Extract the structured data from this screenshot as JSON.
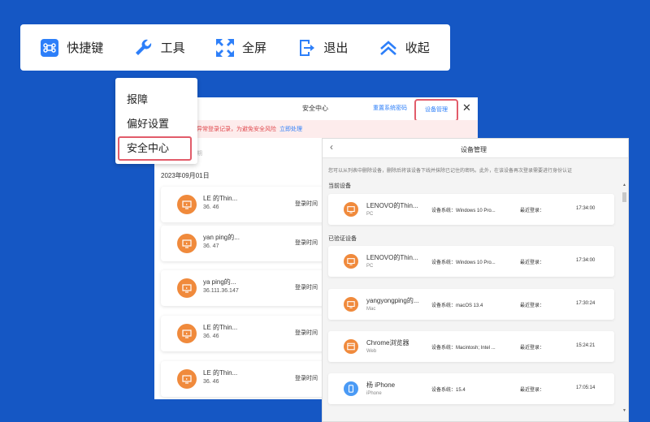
{
  "toolbar": {
    "items": [
      {
        "label": "快捷键",
        "icon": "command-icon"
      },
      {
        "label": "工具",
        "icon": "wrench-icon"
      },
      {
        "label": "全屏",
        "icon": "fullscreen-icon"
      },
      {
        "label": "退出",
        "icon": "exit-icon"
      },
      {
        "label": "收起",
        "icon": "collapse-icon"
      }
    ]
  },
  "dropdown": {
    "items": [
      "报障",
      "偏好设置",
      "安全中心"
    ],
    "selected": "安全中心"
  },
  "security_center": {
    "title": "安全中心",
    "reset_password": "重置系统密码",
    "device_management": "设备管理",
    "alert_text": "异常登录记录，为避免安全风险",
    "alert_action": "立即处理",
    "filter_hint": "期",
    "date": "2023年09月01日",
    "records": [
      {
        "name": "LE        的Thin...",
        "ip": "36.          46",
        "label": "登录时间"
      },
      {
        "name": "yan     ping的...",
        "ip": "36.          47",
        "label": "登录时间"
      },
      {
        "name": "ya          ping的...",
        "ip": "36.111.36.147",
        "label": "登录时间"
      },
      {
        "name": "LE        的Thin...",
        "ip": "36.          46",
        "label": "登录时间"
      },
      {
        "name": "LE        的Thin...",
        "ip": "36.          46",
        "label": "登录时间"
      }
    ]
  },
  "device_mgmt": {
    "title": "设备管理",
    "description": "您可以从列表中删除设备，删除后将该设备下线并抹除已记住的密码。此外，在该设备再次登录需要进行身份认证",
    "current_section": "当前设备",
    "verified_section": "已验证设备",
    "sys_label": "设备系统：",
    "last_label": "最近登录：",
    "current": [
      {
        "name": "LENOVO的Thin...",
        "type": "PC",
        "os": "Windows 10 Pro...",
        "time": "17:34:00",
        "icon": "monitor-icon",
        "color": "orange"
      }
    ],
    "verified": [
      {
        "name": "LENOVO的Thin...",
        "type": "PC",
        "os": "Windows 10 Pro...",
        "time": "17:34:00",
        "icon": "monitor-icon",
        "color": "orange"
      },
      {
        "name": "yangyongping的...",
        "type": "Mac",
        "os": "macOS 13.4",
        "time": "17:30:24",
        "icon": "monitor-icon",
        "color": "orange"
      },
      {
        "name": "Chrome浏览器",
        "type": "Web",
        "os": "Macintosh; Intel ...",
        "time": "15:24:21",
        "icon": "browser-icon",
        "color": "orange"
      },
      {
        "name": "杨      iPhone",
        "type": "iPhone",
        "os": "15.4",
        "time": "17:05:14",
        "icon": "phone-icon",
        "color": "blue"
      }
    ]
  },
  "colors": {
    "background": "#1557c4",
    "accent": "#2d7ff9",
    "highlight": "#e25c6a",
    "orange": "#f08a3c"
  }
}
